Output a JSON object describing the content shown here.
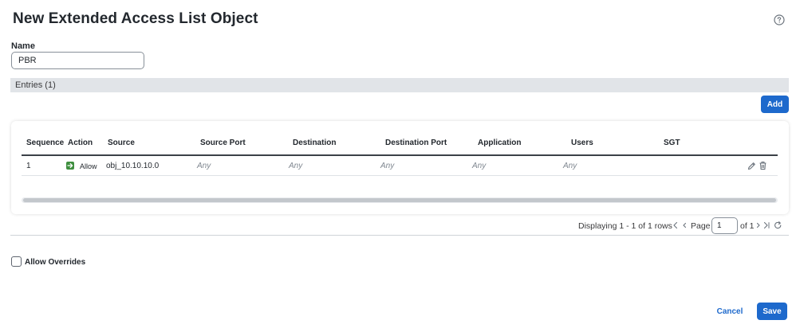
{
  "dialog": {
    "title": "New Extended Access List Object",
    "help_icon": "question-circle-icon"
  },
  "name_field": {
    "label": "Name",
    "value": "PBR"
  },
  "entries": {
    "label": "Entries (1)",
    "add_label": "Add"
  },
  "table": {
    "columns": [
      "Sequence",
      "Action",
      "Source",
      "Source Port",
      "Destination",
      "Destination Port",
      "Application",
      "Users",
      "SGT"
    ],
    "rows": [
      {
        "sequence": "1",
        "action": "Allow",
        "action_icon": "allow-arrow-icon",
        "action_color": "#3f8f3f",
        "source": "obj_10.10.10.0",
        "source_port": "Any",
        "destination": "Any",
        "destination_port": "Any",
        "application": "Any",
        "users": "Any",
        "sgt": ""
      }
    ]
  },
  "pager": {
    "summary": "Displaying 1 - 1 of 1 rows",
    "page_label": "Page",
    "page_value": "1",
    "of_label": "of 1"
  },
  "options": {
    "allow_overrides_label": "Allow Overrides",
    "allow_overrides_checked": false
  },
  "footer": {
    "cancel_label": "Cancel",
    "save_label": "Save"
  },
  "colors": {
    "primary": "#1d69cc",
    "allow": "#3f8f3f",
    "header_bar": "#e1e4e8"
  }
}
